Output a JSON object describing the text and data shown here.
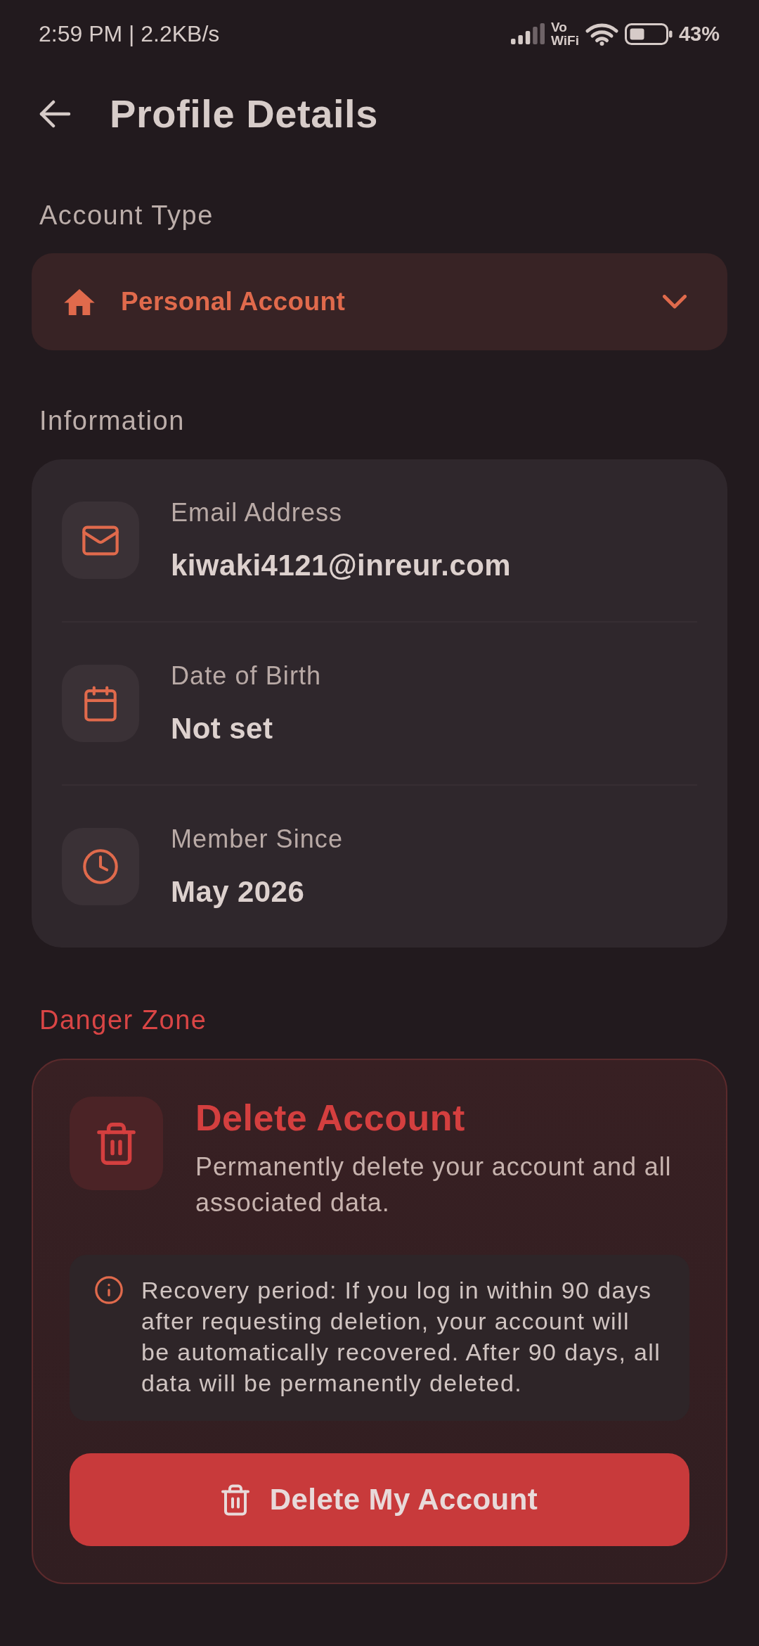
{
  "status_bar": {
    "time": "2:59 PM | 2.2KB/s",
    "network_badge": [
      "Vo",
      "WiFi"
    ],
    "battery": "43%"
  },
  "header": {
    "title": "Profile Details"
  },
  "account_type": {
    "label": "Account Type",
    "value": "Personal Account"
  },
  "information": {
    "label": "Information",
    "rows": [
      {
        "label": "Email Address",
        "value": "kiwaki4121@inreur.com"
      },
      {
        "label": "Date of Birth",
        "value": "Not set"
      },
      {
        "label": "Member Since",
        "value": "May 2026"
      }
    ]
  },
  "danger_zone": {
    "label": "Danger Zone",
    "title": "Delete Account",
    "description": "Permanently delete your account and all associated data.",
    "notice": "Recovery period: If you log in within 90 days after requesting deletion, your account will be automatically recovered. After 90 days, all data will be permanently deleted.",
    "button": "Delete My Account"
  }
}
